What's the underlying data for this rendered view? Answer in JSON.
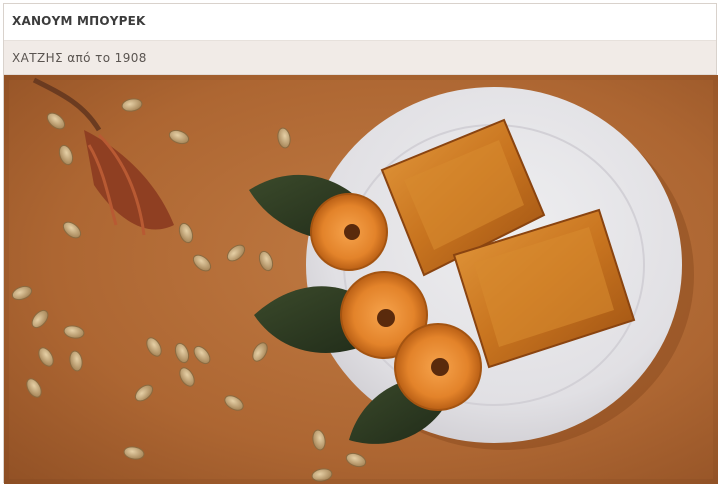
{
  "header": {
    "title": "ΧΑΝΟΥΜ ΜΠΟΥΡΕΚ",
    "subtitle": "ΧΑΤΖΗΣ από το 1908"
  },
  "photo": {
    "background_color": "#b16a35",
    "plate_color": "#e4e3e6",
    "pastry_color": "#c8741f"
  }
}
